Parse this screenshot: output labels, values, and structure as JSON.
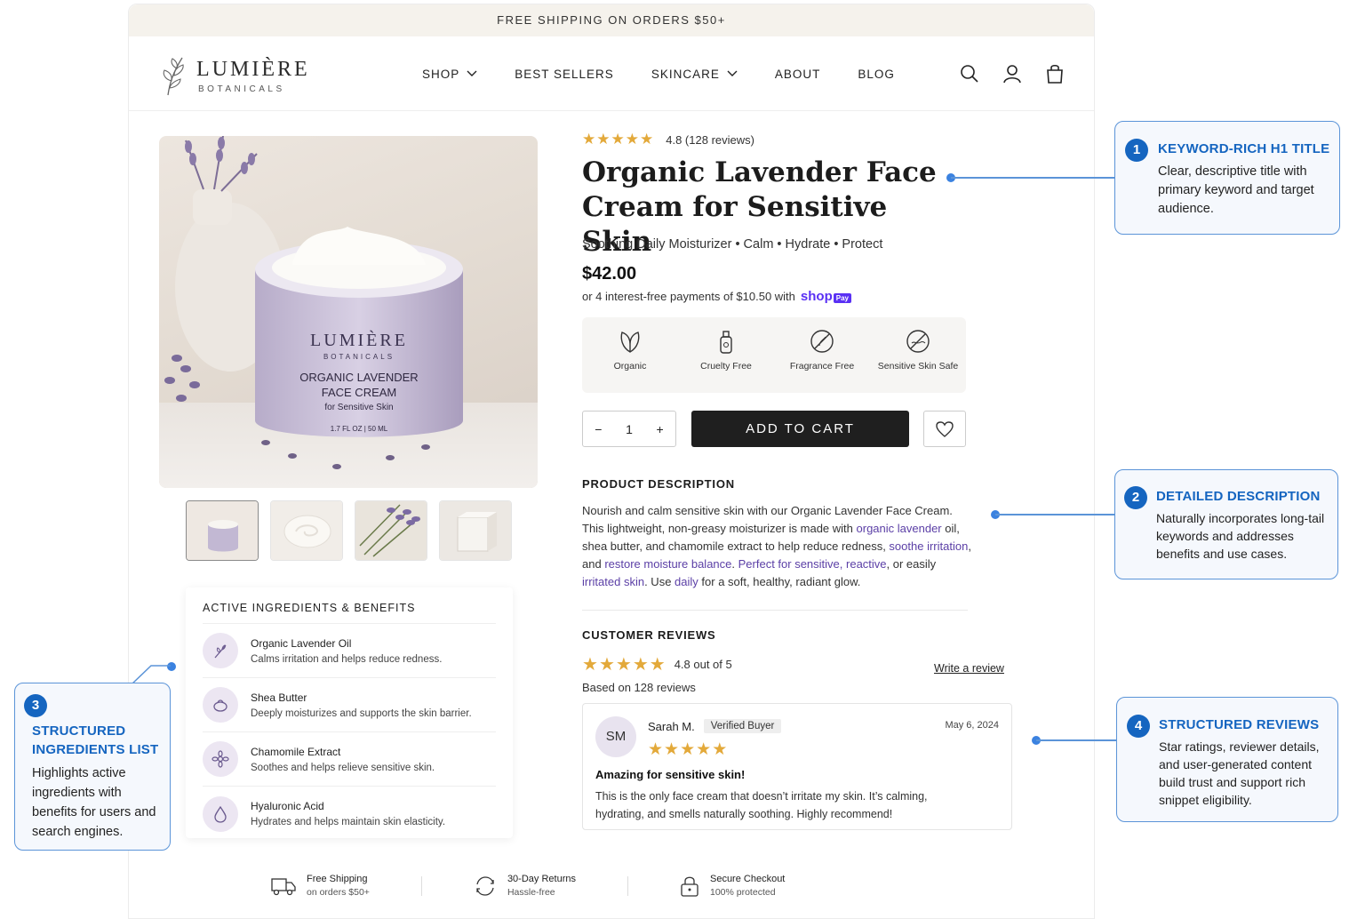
{
  "announcement": "FREE SHIPPING ON ORDERS $50+",
  "brand": {
    "name": "LUMIÈRE",
    "subname": "BOTANICALS"
  },
  "nav": [
    {
      "label": "SHOP",
      "has_dropdown": true
    },
    {
      "label": "BEST SELLERS",
      "has_dropdown": false
    },
    {
      "label": "SKINCARE",
      "has_dropdown": true
    },
    {
      "label": "ABOUT",
      "has_dropdown": false
    },
    {
      "label": "BLOG",
      "has_dropdown": false
    }
  ],
  "header_icons": [
    "search-icon",
    "account-icon",
    "bag-icon"
  ],
  "product": {
    "jar_brand": "LUMIÈRE",
    "jar_sub": "BOTANICALS",
    "jar_name_1": "ORGANIC LAVENDER",
    "jar_name_2": "FACE CREAM",
    "jar_tag": "for Sensitive Skin",
    "jar_size": "1.7 FL OZ | 50 ML",
    "rating_text": "4.8 (128 reviews)",
    "rating": 4.8,
    "title": "Organic Lavender Face Cream for Sensitive Skin",
    "subtitle": "Soothing Daily Moisturizer • Calm • Hydrate • Protect",
    "price": "$42.00",
    "installments": "or 4 interest-free payments of $10.50 with",
    "shop_pay_word": "shop",
    "shop_pay_badge": "Pay",
    "badges": [
      {
        "label": "Organic",
        "icon": "leaf-icon"
      },
      {
        "label": "Cruelty Free",
        "icon": "bottle-icon"
      },
      {
        "label": "Fragrance Free",
        "icon": "no-fragrance-icon"
      },
      {
        "label": "Sensitive Skin Safe",
        "icon": "sensitive-skin-icon"
      }
    ],
    "quantity": "1",
    "add_to_cart": "ADD TO CART"
  },
  "ingredients": {
    "title": "ACTIVE INGREDIENTS & BENEFITS",
    "items": [
      {
        "name": "Organic Lavender Oil",
        "desc": "Calms irritation and helps reduce redness.",
        "icon": "lavender-icon"
      },
      {
        "name": "Shea Butter",
        "desc": "Deeply moisturizes and supports the skin barrier.",
        "icon": "shea-icon"
      },
      {
        "name": "Chamomile Extract",
        "desc": "Soothes and helps relieve sensitive skin.",
        "icon": "flower-icon"
      },
      {
        "name": "Hyaluronic Acid",
        "desc": "Hydrates and helps maintain skin elasticity.",
        "icon": "droplet-icon"
      }
    ]
  },
  "description": {
    "title": "PRODUCT DESCRIPTION",
    "segments": [
      {
        "t": "Nourish and calm sensitive skin with our Organic Lavender Face Cream. This lightweight, non-greasy moisturizer is made with ",
        "hl": false
      },
      {
        "t": "organic lavender",
        "hl": true
      },
      {
        "t": " oil, shea butter, and chamomile extract to help reduce redness, ",
        "hl": false
      },
      {
        "t": "soothe irritation",
        "hl": true
      },
      {
        "t": ", and ",
        "hl": false
      },
      {
        "t": "restore moisture balance",
        "hl": true
      },
      {
        "t": ". ",
        "hl": false
      },
      {
        "t": "Perfect for sensitive, reactive",
        "hl": true
      },
      {
        "t": ", or easily ",
        "hl": false
      },
      {
        "t": "irritated skin",
        "hl": true
      },
      {
        "t": ". Use ",
        "hl": false
      },
      {
        "t": "daily",
        "hl": true
      },
      {
        "t": " for a soft, healthy, radiant glow.",
        "hl": false
      }
    ]
  },
  "reviews": {
    "title": "CUSTOMER REVIEWS",
    "summary": "4.8 out of 5",
    "rating": 4.8,
    "based_on": "Based on 128 reviews",
    "write_link": "Write a review",
    "items": [
      {
        "initials": "SM",
        "name": "Sarah M.",
        "badge": "Verified Buyer",
        "date": "May 6, 2024",
        "stars": 5,
        "title": "Amazing for sensitive skin!",
        "body": "This is the only face cream that doesn’t irritate my skin. It’s calming, hydrating, and smells naturally soothing. Highly recommend!"
      }
    ]
  },
  "footer": [
    {
      "title": "Free Shipping",
      "sub": "on orders $50+",
      "icon": "truck-icon"
    },
    {
      "title": "30-Day Returns",
      "sub": "Hassle-free",
      "icon": "returns-icon"
    },
    {
      "title": "Secure Checkout",
      "sub": "100% protected",
      "icon": "lock-icon"
    }
  ],
  "annotations": [
    {
      "num": "1",
      "title": "KEYWORD-RICH H1 TITLE",
      "body": "Clear, descriptive title with primary keyword and target audience."
    },
    {
      "num": "2",
      "title": "DETAILED DESCRIPTION",
      "body": "Naturally incorporates long-tail keywords and addresses benefits and use cases."
    },
    {
      "num": "3",
      "title": "STRUCTURED INGREDIENTS LIST",
      "body": "Highlights active ingredients with benefits for users and search engines."
    },
    {
      "num": "4",
      "title": "STRUCTURED REVIEWS",
      "body": "Star ratings, reviewer details, and user-generated content build trust and support rich snippet eligibility."
    }
  ],
  "colors": {
    "accent": "#1565c0",
    "highlight": "#5b3fa6",
    "star": "#e3a93a",
    "button": "#1f1f1f",
    "shop_pay": "#5a31f4"
  }
}
